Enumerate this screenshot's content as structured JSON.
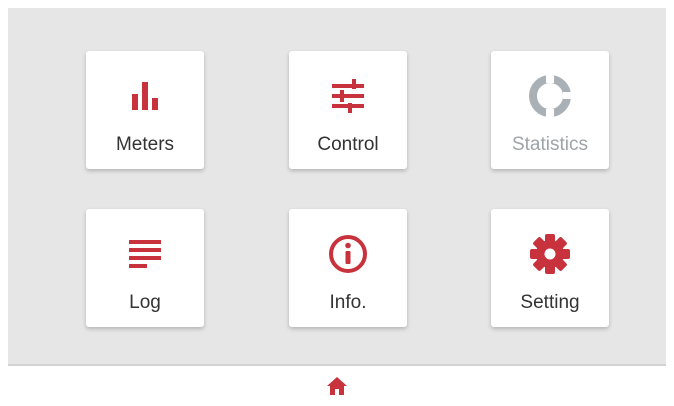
{
  "colors": {
    "accent": "#c8323c",
    "disabled": "#a9b0b6",
    "background": "#e6e6e6",
    "tile": "#ffffff"
  },
  "tiles": [
    {
      "label": "Meters",
      "icon": "bar-chart-icon",
      "enabled": true
    },
    {
      "label": "Control",
      "icon": "sliders-icon",
      "enabled": true
    },
    {
      "label": "Statistics",
      "icon": "donut-chart-icon",
      "enabled": false
    },
    {
      "label": "Log",
      "icon": "list-lines-icon",
      "enabled": true
    },
    {
      "label": "Info.",
      "icon": "info-circle-icon",
      "enabled": true
    },
    {
      "label": "Setting",
      "icon": "gear-icon",
      "enabled": true
    }
  ],
  "footer": {
    "home_icon": "home-icon"
  }
}
